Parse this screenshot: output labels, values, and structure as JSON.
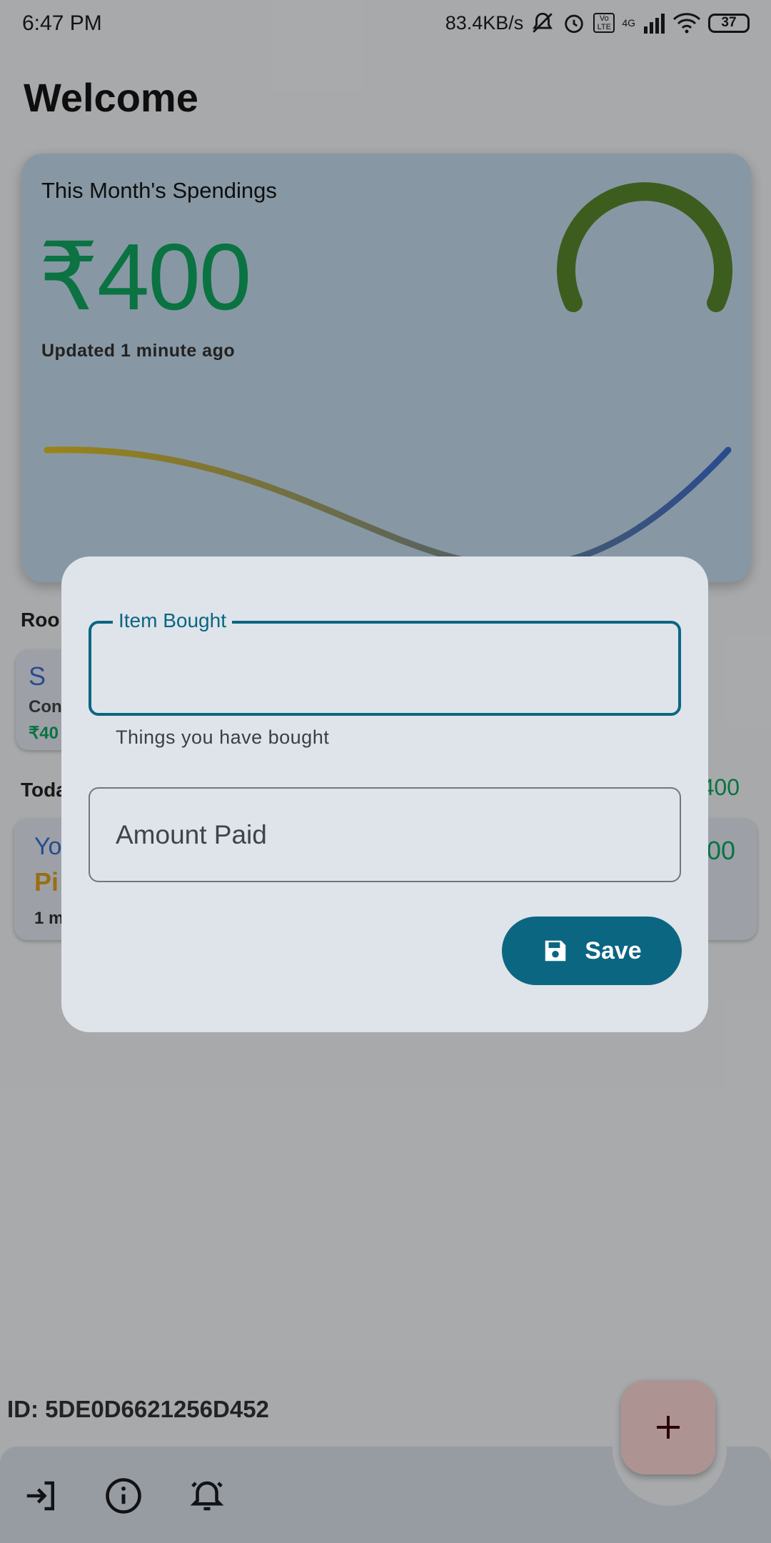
{
  "status_bar": {
    "time": "6:47 PM",
    "network_speed": "83.4KB/s",
    "volte_text": "Vo LTE",
    "network_type": "4G",
    "battery": "37",
    "icons": [
      "bell-off-icon",
      "alarm-icon",
      "volte-icon",
      "signal-icon",
      "wifi-icon",
      "battery-icon"
    ]
  },
  "header": {
    "title": "Welcome"
  },
  "spending_card": {
    "title": "This Month's Spendings",
    "amount": "₹400",
    "updated": "Updated 1 minute ago",
    "gauge_fraction": 1.0,
    "colors": {
      "amount": "#11a862",
      "gauge": "#5b8a2e",
      "curve_start": "#e4c224",
      "curve_end": "#3d6fd2"
    }
  },
  "rooms": {
    "label": "Roo",
    "card": {
      "initial": "S",
      "subtitle": "Con",
      "amount": "₹40"
    }
  },
  "today": {
    "label": "Toda",
    "total": "400",
    "card": {
      "who": "Yo",
      "item": "Pi",
      "time": "1 m",
      "amount": "00"
    }
  },
  "user_id": "ID: 5DE0D6621256D452",
  "bottom_bar": {
    "icons": [
      "logout-icon",
      "info-icon",
      "notification-bell-icon"
    ],
    "fab_icon": "plus-icon"
  },
  "dialog": {
    "item_field": {
      "label": "Item Bought",
      "value": "",
      "helper": "Things you have bought"
    },
    "amount_field": {
      "label": "Amount Paid",
      "value": ""
    },
    "save_button": {
      "label": "Save",
      "icon": "save-icon"
    },
    "colors": {
      "primary": "#0b6682",
      "surface": "#dee4ea"
    }
  }
}
